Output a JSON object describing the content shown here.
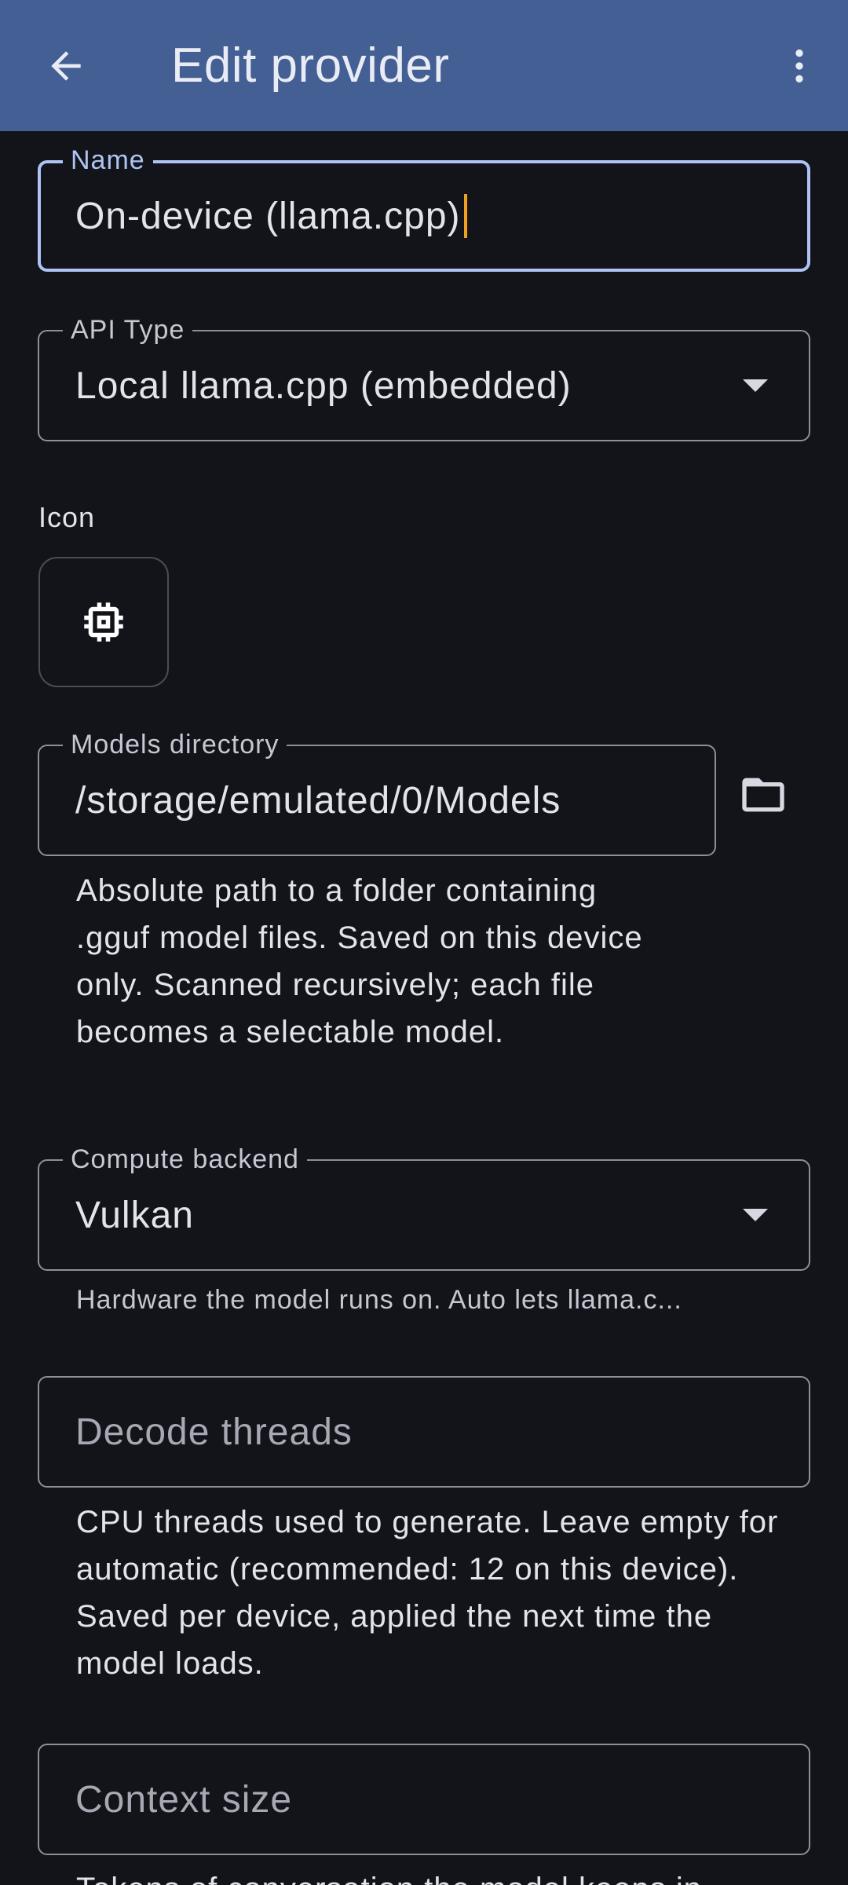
{
  "appbar": {
    "title": "Edit provider",
    "back_icon": "arrow-back-icon",
    "more_icon": "more-vert-icon"
  },
  "form": {
    "name": {
      "label": "Name",
      "value": "On-device (llama.cpp)"
    },
    "api_type": {
      "label": "API Type",
      "value": "Local llama.cpp (embedded)"
    },
    "icon": {
      "label": "Icon",
      "icon_name": "chip-icon"
    },
    "models_directory": {
      "label": "Models directory",
      "value": "/storage/emulated/0/Models",
      "helper": "Absolute path to a folder containing .gguf model files. Saved on this device only. Scanned recursively; each file becomes a selectable model.",
      "browse_icon": "folder-icon"
    },
    "compute_backend": {
      "label": "Compute backend",
      "value": "Vulkan",
      "helper": "Hardware the model runs on. Auto lets llama.c..."
    },
    "decode_threads": {
      "placeholder": "Decode threads",
      "helper": "CPU threads used to generate. Leave empty for automatic (recommended: 12 on this device). Saved per device, applied the next time the model loads."
    },
    "context_size": {
      "placeholder": "Context size",
      "helper": "Tokens of conversation the model keeps in"
    }
  },
  "colors": {
    "appbar": "#435f93",
    "background": "#131419",
    "focus": "#aec4f4",
    "caret": "#f0a020"
  }
}
